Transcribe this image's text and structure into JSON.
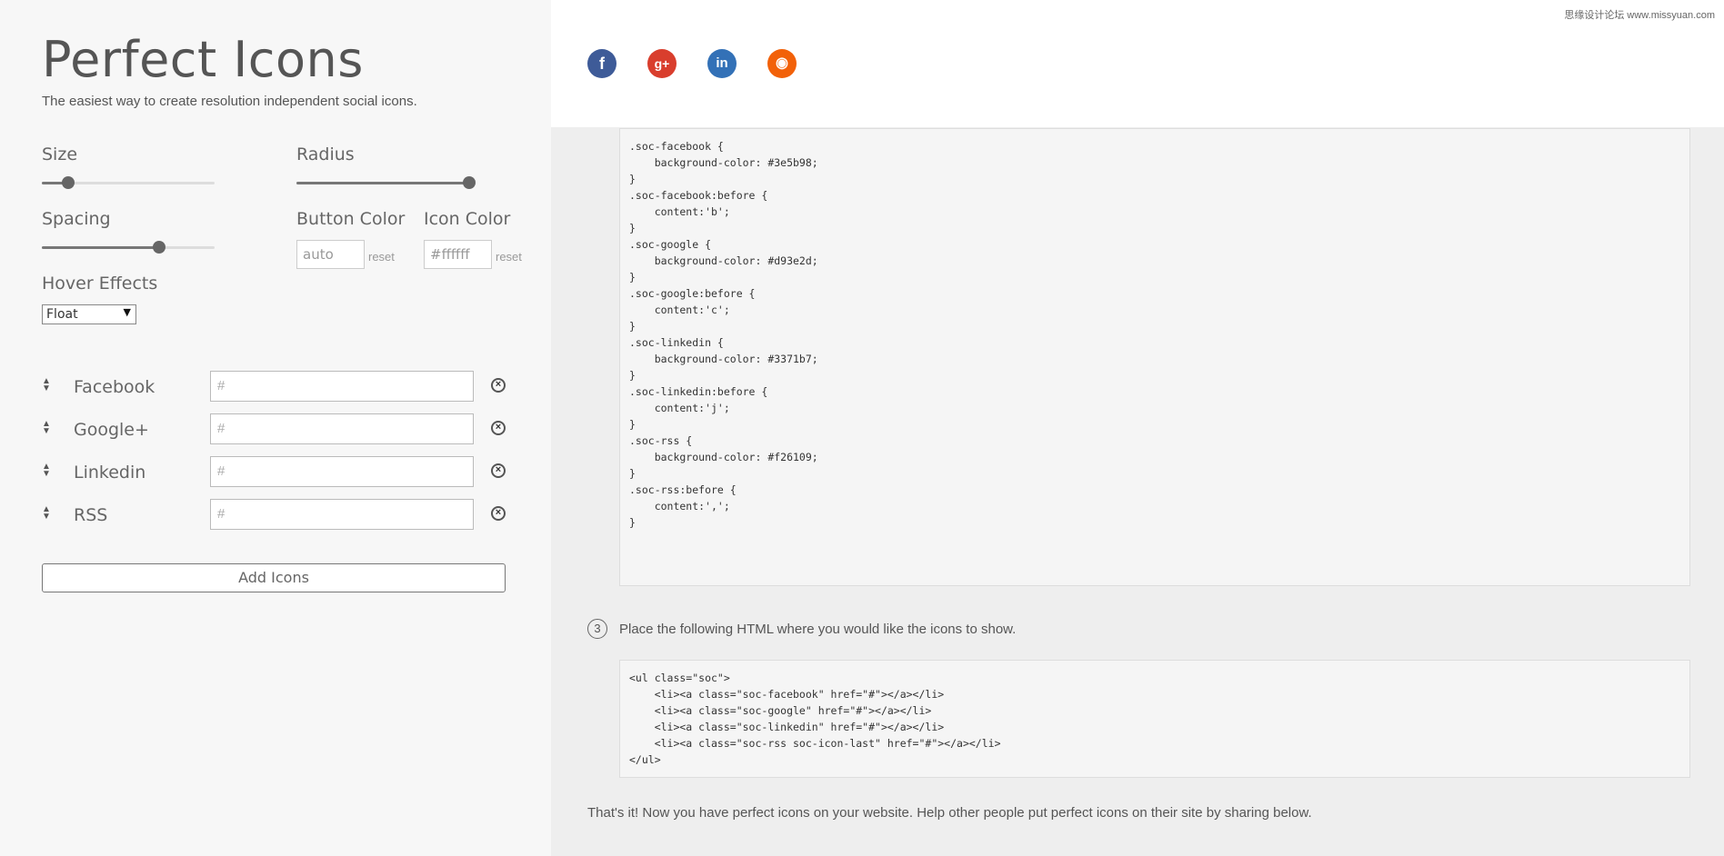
{
  "app": {
    "title": "Perfect Icons",
    "subtitle": "The easiest way to create resolution independent social icons."
  },
  "controls": {
    "size_label": "Size",
    "size_value": 0.15,
    "radius_label": "Radius",
    "radius_value": 1.0,
    "spacing_label": "Spacing",
    "spacing_value": 0.68,
    "button_color_label": "Button Color",
    "button_color_placeholder": "auto",
    "button_color_reset": "reset",
    "icon_color_label": "Icon Color",
    "icon_color_placeholder": "#ffffff",
    "icon_color_reset": "reset",
    "hover_label": "Hover Effects",
    "hover_selected": "Float"
  },
  "networks": [
    {
      "name": "Facebook",
      "url": "#"
    },
    {
      "name": "Google+",
      "url": "#"
    },
    {
      "name": "Linkedin",
      "url": "#"
    },
    {
      "name": "RSS",
      "url": "#"
    }
  ],
  "add_button": "Add Icons",
  "preview": {
    "icons": [
      {
        "name": "facebook",
        "glyph": "f",
        "color": "#3e5b98"
      },
      {
        "name": "google",
        "glyph": "g+",
        "color": "#d93e2d"
      },
      {
        "name": "linkedin",
        "glyph": "in",
        "color": "#3371b7"
      },
      {
        "name": "rss",
        "glyph": "◉",
        "color": "#f26109"
      }
    ],
    "watermark": "思缘设计论坛 www.missyuan.com"
  },
  "css_code": ".soc-facebook {\n    background-color: #3e5b98;\n}\n.soc-facebook:before {\n    content:'b';\n}\n.soc-google {\n    background-color: #d93e2d;\n}\n.soc-google:before {\n    content:'c';\n}\n.soc-linkedin {\n    background-color: #3371b7;\n}\n.soc-linkedin:before {\n    content:'j';\n}\n.soc-rss {\n    background-color: #f26109;\n}\n.soc-rss:before {\n    content:',';\n}",
  "step3": {
    "number": "3",
    "text": "Place the following HTML where you would like the icons to show."
  },
  "html_code": "<ul class=\"soc\">\n    <li><a class=\"soc-facebook\" href=\"#\"></a></li>\n    <li><a class=\"soc-google\" href=\"#\"></a></li>\n    <li><a class=\"soc-linkedin\" href=\"#\"></a></li>\n    <li><a class=\"soc-rss soc-icon-last\" href=\"#\"></a></li>\n</ul>",
  "final_text": "That's it! Now you have perfect icons on your website. Help other people put perfect icons on their site by sharing below."
}
